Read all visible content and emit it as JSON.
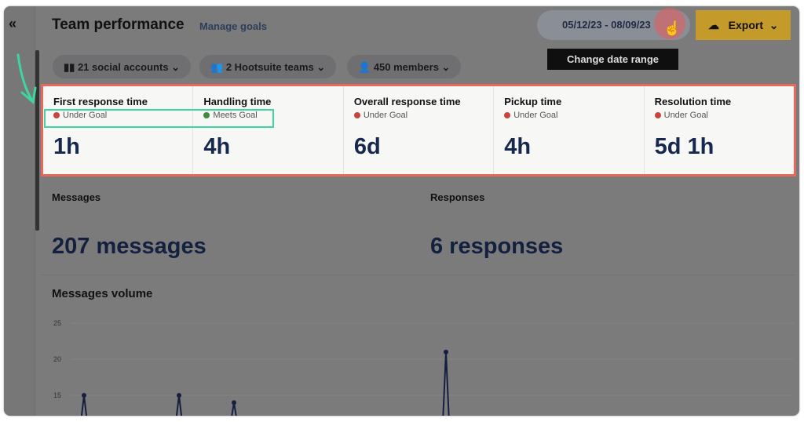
{
  "header": {
    "title": "Team performance",
    "manage_goals": "Manage goals",
    "date_range": "05/12/23 - 08/09/23",
    "export": "Export",
    "tooltip": "Change date range",
    "collapse": "«"
  },
  "filters": [
    {
      "icon": "bar-chart-icon",
      "label": "21 social accounts"
    },
    {
      "icon": "teams-icon",
      "label": "2 Hootsuite teams"
    },
    {
      "icon": "person-icon",
      "label": "450 members"
    }
  ],
  "metrics": [
    {
      "title": "First response time",
      "status": "Under Goal",
      "status_color": "#c9453b",
      "value": "1h"
    },
    {
      "title": "Handling time",
      "status": "Meets Goal",
      "status_color": "#3f8a3f",
      "value": "4h"
    },
    {
      "title": "Overall response time",
      "status": "Under Goal",
      "status_color": "#c9453b",
      "value": "6d"
    },
    {
      "title": "Pickup time",
      "status": "Under Goal",
      "status_color": "#c9453b",
      "value": "4h"
    },
    {
      "title": "Resolution time",
      "status": "Under Goal",
      "status_color": "#c9453b",
      "value": "5d 1h"
    }
  ],
  "messages": {
    "label": "Messages",
    "value": "207 messages"
  },
  "responses": {
    "label": "Responses",
    "value": "6 responses"
  },
  "colors": {
    "highlight_border": "#e8685a",
    "annotation": "#3dd6a0",
    "export": "#c49a2a"
  },
  "chart_data": {
    "type": "line",
    "title": "Messages volume",
    "yticks": [
      25,
      20,
      15
    ],
    "ylim_visible": [
      12,
      25
    ],
    "grid": true,
    "peaks": [
      15,
      15,
      14,
      21
    ]
  }
}
